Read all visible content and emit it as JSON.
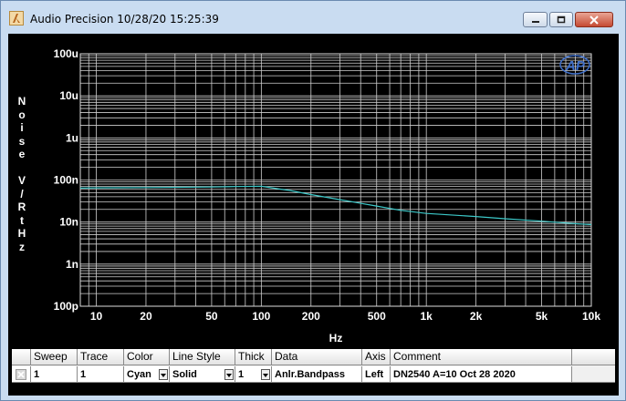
{
  "window": {
    "title": "Audio Precision  10/28/20 15:25:39",
    "icons": {
      "app": "ap-app-icon",
      "minimize": "minimize-icon",
      "maximize": "maximize-icon",
      "close": "close-icon"
    }
  },
  "graph": {
    "logo": "AP",
    "y_axis_letters": [
      "N",
      "o",
      "i",
      "s",
      "e",
      "",
      "V",
      "/",
      "R",
      "t",
      "H",
      "z"
    ]
  },
  "chart_data": {
    "type": "line",
    "xlabel": "Hz",
    "ylabel": "Noise V/RtHz",
    "x_scale": "log",
    "y_scale": "log",
    "xlim": [
      8,
      10000
    ],
    "ylim": [
      1e-13,
      0.0001
    ],
    "x_ticks": [
      {
        "v": 10,
        "label": "10"
      },
      {
        "v": 20,
        "label": "20"
      },
      {
        "v": 50,
        "label": "50"
      },
      {
        "v": 100,
        "label": "100"
      },
      {
        "v": 200,
        "label": "200"
      },
      {
        "v": 500,
        "label": "500"
      },
      {
        "v": 1000,
        "label": "1k"
      },
      {
        "v": 2000,
        "label": "2k"
      },
      {
        "v": 5000,
        "label": "5k"
      },
      {
        "v": 10000,
        "label": "10k"
      }
    ],
    "y_ticks": [
      {
        "v": 0.0001,
        "label": "100u"
      },
      {
        "v": 1e-05,
        "label": "10u"
      },
      {
        "v": 1e-06,
        "label": "1u"
      },
      {
        "v": 1e-07,
        "label": "100n"
      },
      {
        "v": 1e-08,
        "label": "10n"
      },
      {
        "v": 1e-09,
        "label": "1n"
      },
      {
        "v": 1e-10,
        "label": "100p"
      }
    ],
    "grid": true,
    "series": [
      {
        "color": "#3cc8c8",
        "x": [
          8,
          10,
          20,
          50,
          70,
          100,
          150,
          200,
          300,
          500,
          700,
          1000,
          1500,
          2000,
          3000,
          5000,
          7000,
          10000
        ],
        "y": [
          6.4e-08,
          6.5e-08,
          6.6e-08,
          6.8e-08,
          7e-08,
          7.1e-08,
          5.6e-08,
          4.5e-08,
          3.4e-08,
          2.4e-08,
          1.9e-08,
          1.6e-08,
          1.45e-08,
          1.35e-08,
          1.2e-08,
          1.05e-08,
          9.5e-09,
          8.7e-09
        ]
      }
    ]
  },
  "legend": {
    "headers": {
      "sweep": "Sweep",
      "trace": "Trace",
      "color": "Color",
      "line_style": "Line Style",
      "thick": "Thick",
      "data": "Data",
      "axis": "Axis",
      "comment": "Comment"
    },
    "row": {
      "sweep": "1",
      "trace": "1",
      "color": "Cyan",
      "line_style": "Solid",
      "thick": "1",
      "data": "Anlr.Bandpass",
      "axis": "Left",
      "comment": "DN2540 A=10 Oct 28 2020"
    }
  }
}
